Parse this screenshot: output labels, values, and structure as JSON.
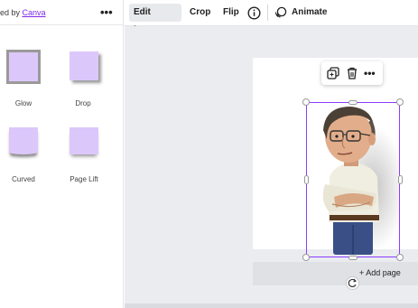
{
  "left_panel": {
    "brand_prefix": "ed by ",
    "brand_link": "Canva",
    "effects": [
      {
        "label": "Glow"
      },
      {
        "label": "Drop"
      },
      {
        "label": "Curved"
      },
      {
        "label": "Page Lift"
      }
    ]
  },
  "toolbar": {
    "edit_image": "Edit image",
    "crop": "Crop",
    "flip": "Flip",
    "animate": "Animate"
  },
  "canvas": {
    "add_page": "+ Add page"
  },
  "colors": {
    "accent": "#8b3dff",
    "tile": "#dcc7fb",
    "canvas_bg": "#ebecf0"
  }
}
